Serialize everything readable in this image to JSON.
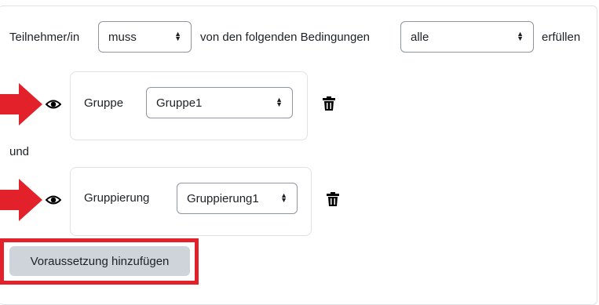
{
  "header": {
    "participant_label": "Teilnehmer/in",
    "mode_select": {
      "value": "muss"
    },
    "middle_text": "von den folgenden Bedingungen",
    "scope_select": {
      "value": "alle"
    },
    "suffix_text": "erfüllen"
  },
  "conditions": [
    {
      "type_label": "Gruppe",
      "select_value": "Gruppe1",
      "visibility_icon": "eye-icon",
      "delete_icon": "trash-icon",
      "pointer_icon": "red-arrow-icon"
    },
    {
      "type_label": "Gruppierung",
      "select_value": "Gruppierung1",
      "visibility_icon": "eye-icon",
      "delete_icon": "trash-icon",
      "pointer_icon": "red-arrow-icon"
    }
  ],
  "connector_text": "und",
  "add_button_label": "Voraussetzung hinzufügen",
  "colors": {
    "highlight": "#e2212a",
    "button_bg": "#ced4da",
    "border": "#dee2e6"
  }
}
